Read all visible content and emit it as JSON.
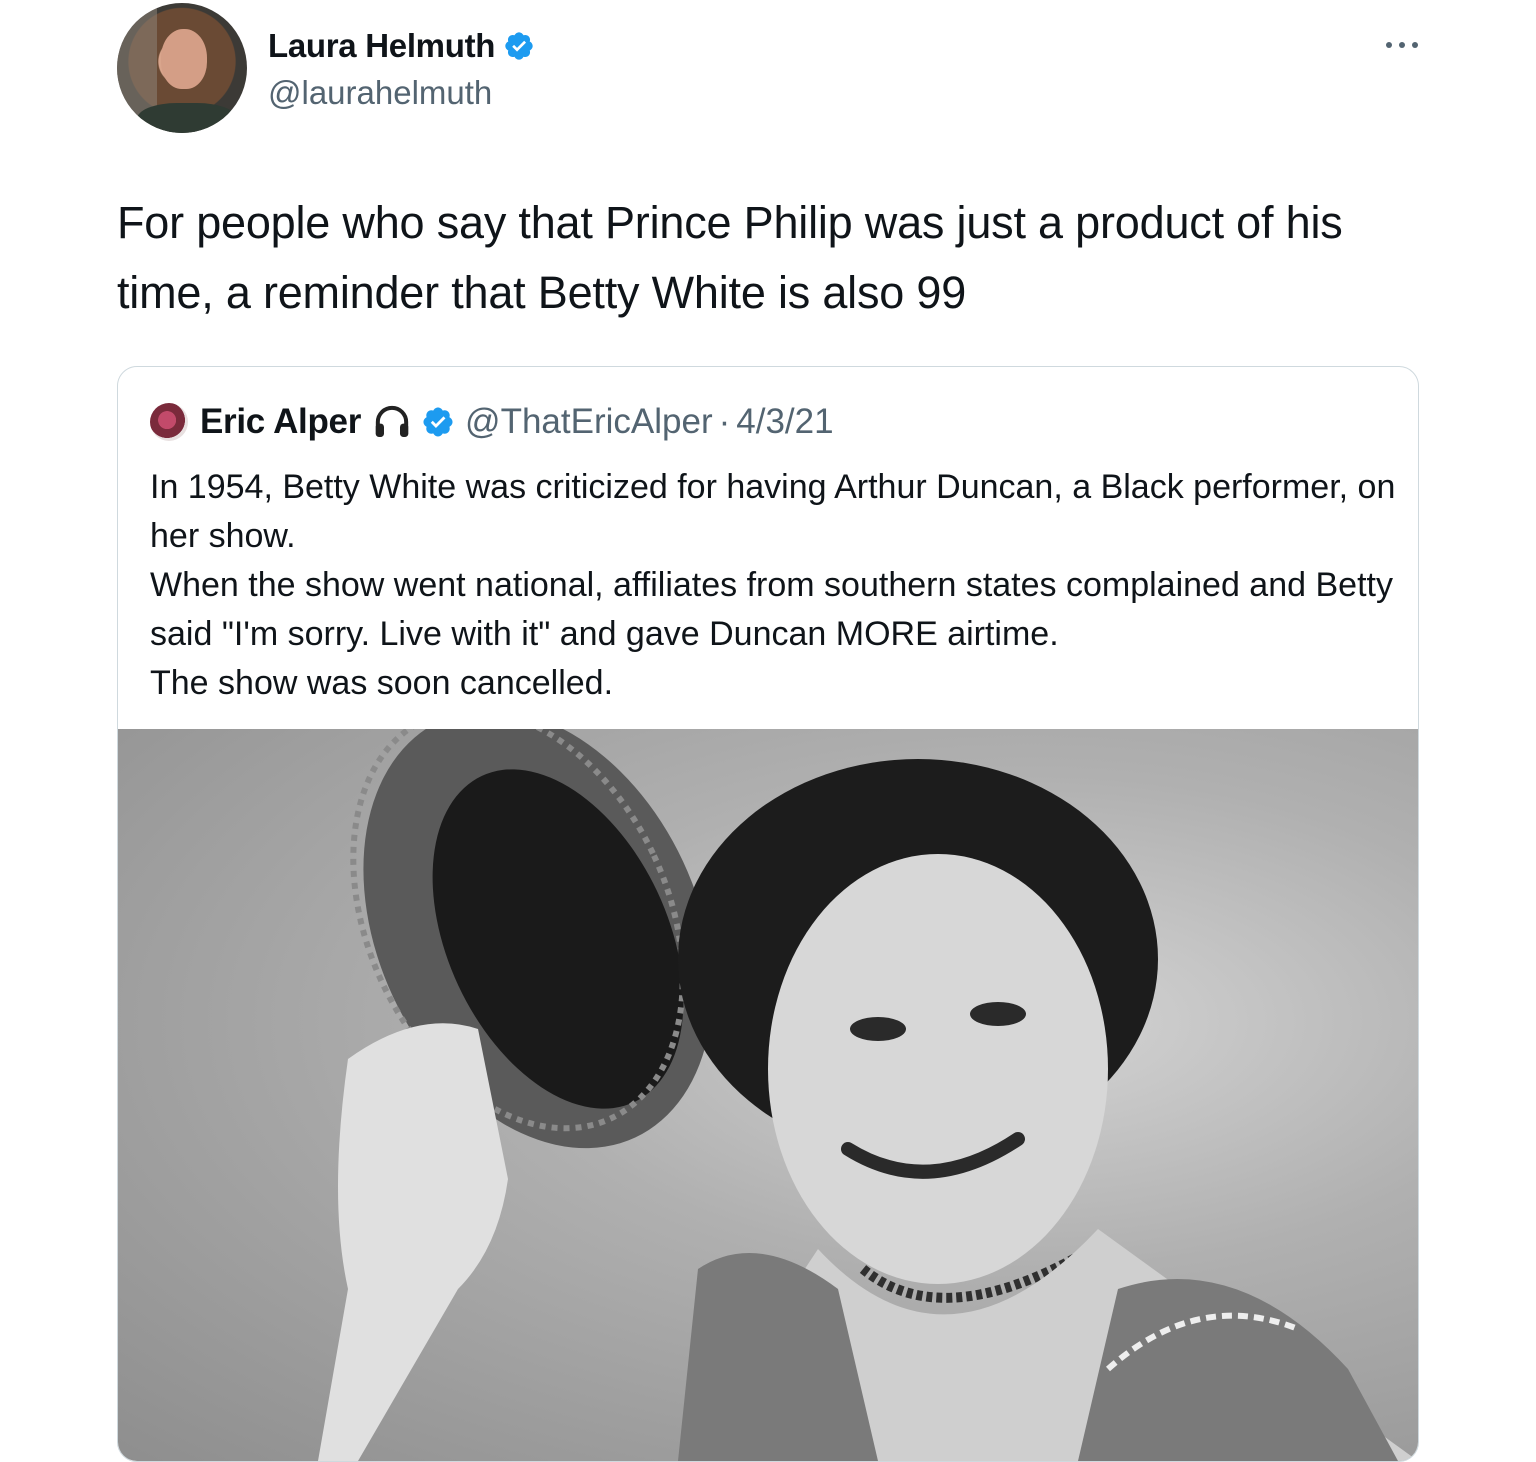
{
  "author": {
    "display_name": "Laura Helmuth",
    "handle": "@laurahelmuth",
    "verified_icon": "verified-badge-icon",
    "avatar": "profile-avatar"
  },
  "tweet": {
    "text": "For people who say that Prince Philip was just a product of his time, a reminder that Betty White is also 99"
  },
  "more_icon": "more-options-icon",
  "quote": {
    "display_name": "Eric Alper",
    "emoji_icon": "headphones-icon",
    "verified_icon": "verified-badge-icon",
    "handle": "@ThatEricAlper",
    "separator": "·",
    "date": "4/3/21",
    "lines": [
      "In 1954, Betty White was criticized for having Arthur Duncan, a Black performer, on her show.",
      "When the show went national, affiliates from southern states complained and Betty said \"I'm sorry. Live with it\" and gave Duncan MORE airtime.",
      "The show was soon cancelled."
    ],
    "media": "black-and-white-photo"
  },
  "colors": {
    "text_primary": "#0f1419",
    "text_secondary": "#536471",
    "verified_blue": "#1d9bf0",
    "card_border": "#cfd9de"
  }
}
